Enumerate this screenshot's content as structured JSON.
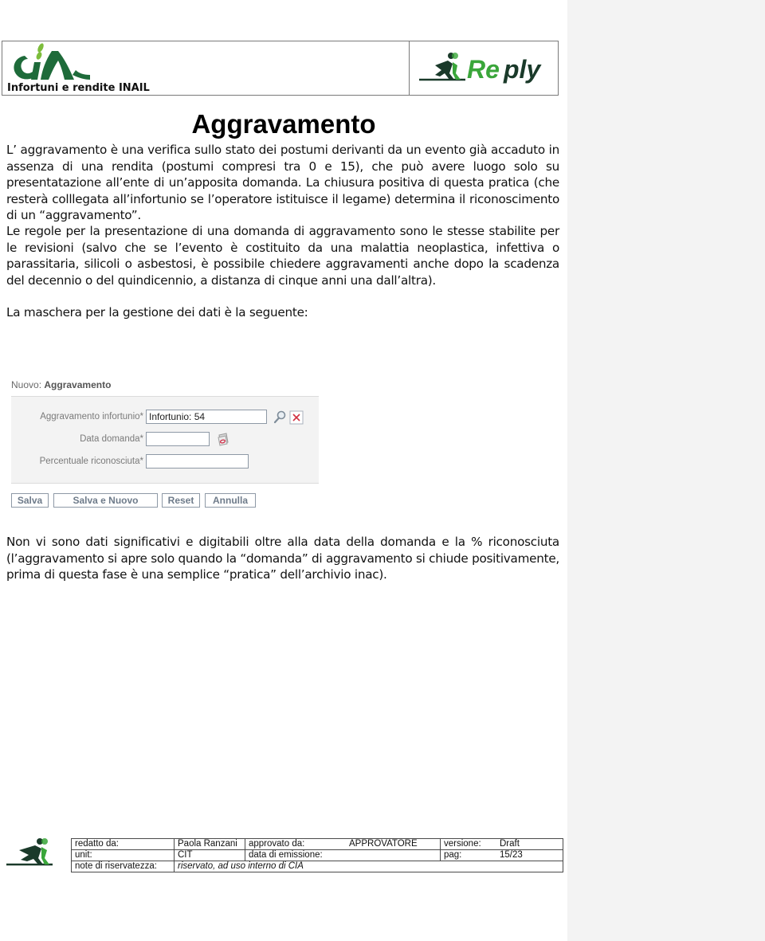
{
  "header": {
    "left_logo": "CIA",
    "subtitle": "Infortuni e rendite INAIL",
    "right_logo": "Reply"
  },
  "title": "Aggravamento",
  "paragraphs": [
    "L’ aggravamento è una verifica sullo stato dei postumi derivanti da un evento già accaduto in assenza di una rendita (postumi compresi tra 0 e 15), che può avere luogo solo su presentatazione all’ente  di un’apposita domanda. La chiusura positiva di questa pratica (che resterà colllegata all’infortunio se l’operatore istituisce il legame) determina il riconoscimento di un “aggravamento”.",
    "Le regole per la presentazione di una domanda di aggravamento sono le stesse stabilite per le revisioni (salvo che se l’evento è costituito da una malattia neoplastica, infettiva o parassitaria, silicoli o asbestosi, è possibile chiedere aggravamenti anche dopo la scadenza del decennio o del quindicennio, a distanza di cinque anni una dall’altra).",
    "La maschera per la gestione dei dati è la seguente:",
    "Non vi sono dati significativi e digitabili oltre alla data della domanda e la % riconosciuta (l’aggravamento si apre solo quando la “domanda” di aggravamento si chiude positivamente, prima di questa fase è una semplice “pratica” dell’archivio inac)."
  ],
  "form": {
    "heading_prefix": "Nuovo:",
    "heading_title": "Aggravamento",
    "fields": [
      {
        "label": "Aggravamento infortunio*",
        "value": "Infortunio: 54",
        "icons": [
          "search-icon",
          "clear-icon"
        ]
      },
      {
        "label": "Data domanda*",
        "value": "",
        "icons": [
          "calendar-icon"
        ]
      },
      {
        "label": "Percentuale riconosciuta*",
        "value": "",
        "icons": []
      }
    ],
    "buttons": {
      "save": "Salva",
      "save_new": "Salva e Nuovo",
      "reset": "Reset",
      "cancel": "Annulla"
    }
  },
  "footer": {
    "redatto_label": "redatto da:",
    "redatto_value": "Paola Ranzani",
    "approvato_label": "approvato da:",
    "approvato_value": "APPROVATORE",
    "versione_label": "versione:",
    "versione_value": "Draft",
    "unit_label": "unit:",
    "unit_value": "CIT",
    "emissione_label": "data di emissione:",
    "emissione_value": "",
    "pag_label": "pag:",
    "pag_value": "15/23",
    "note_label": "note di riservatezza:",
    "note_value": "riservato, ad uso interno di CIA"
  },
  "colors": {
    "cia_green": "#1e6b3a",
    "cia_leaf": "#7dbd3c",
    "reply_green": "#3aa63a",
    "reply_dark": "#1a3a2a",
    "comment_panel": "#f3f3f3"
  }
}
